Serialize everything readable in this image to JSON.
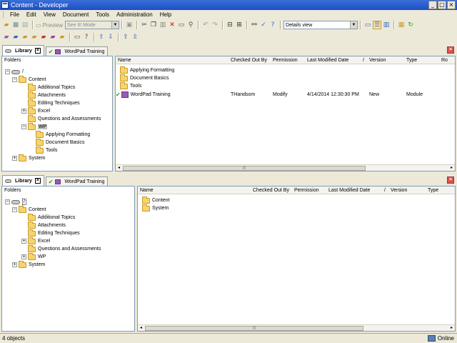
{
  "window": {
    "title": "Content - Developer"
  },
  "menu": [
    "File",
    "Edit",
    "View",
    "Document",
    "Tools",
    "Administration",
    "Help"
  ],
  "toolbar": {
    "preview_label": "Preview",
    "mode_value": "See It! Mode",
    "view_value": "Details view"
  },
  "top_panel": {
    "tabs": [
      {
        "label": "Library"
      },
      {
        "label": "WordPad Training"
      }
    ],
    "folders_header": "Folders",
    "tree": [
      "/",
      "Content",
      "Additional Topics",
      "Attachments",
      "Editing Techniques",
      "Excel",
      "Questions and Assessments",
      "WP",
      "Applying Formatting",
      "Document Basics",
      "Tools",
      "System"
    ],
    "columns": [
      "Name",
      "Checked Out By",
      "Permission",
      "Last Modified Date",
      "/",
      "Version",
      "Type",
      "Ro"
    ],
    "items": [
      {
        "name": "Applying Formatting"
      },
      {
        "name": "Document Basics"
      },
      {
        "name": "Tools"
      },
      {
        "name": "WordPad Training",
        "checked_out_by": "THandsom",
        "permission": "Modify",
        "last_modified": "4/14/2014 12:30:30 PM",
        "version": "New",
        "type": "Module"
      }
    ]
  },
  "bottom_panel": {
    "tabs": [
      {
        "label": "Library"
      },
      {
        "label": "WordPad Training"
      }
    ],
    "folders_header": "Folders",
    "tree": [
      "/",
      "Content",
      "Additional Topics",
      "Attachments",
      "Editing Techniques",
      "Excel",
      "Questions and Assessments",
      "WP",
      "System"
    ],
    "columns": [
      "Name",
      "Checked Out By",
      "Permission",
      "Last Modified Date",
      "/",
      "Version",
      "Type"
    ],
    "items": [
      {
        "name": "Content"
      },
      {
        "name": "System"
      }
    ]
  },
  "status": {
    "objects": "4 objects",
    "connection": "Online"
  }
}
